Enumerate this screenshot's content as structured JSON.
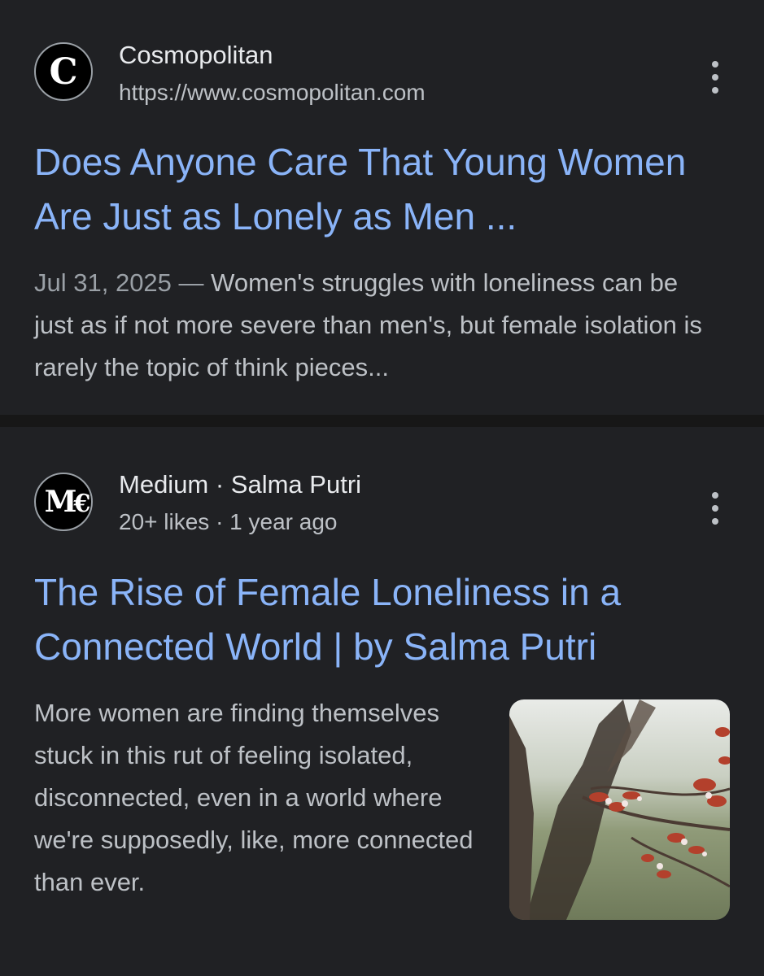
{
  "results": [
    {
      "favicon_letter": "C",
      "site_name": "Cosmopolitan",
      "url": "https://www.cosmopolitan.com",
      "title": "Does Anyone Care That Young Women Are Just as Lonely as Men ...",
      "date": "Jul 31, 2025",
      "date_separator": " — ",
      "snippet": "Women's struggles with loneliness can be just as if not more severe than men's, but female isolation is rarely the topic of think pieces..."
    },
    {
      "favicon_letter": "M",
      "site_name": "Medium · Salma Putri",
      "meta": "20+ likes · 1 year ago",
      "title": "The Rise of Female Loneliness in a Connected World | by Salma Putri",
      "snippet": "More women are finding themselves stuck in this rut of feeling isolated, disconnected, even in a world where we're supposedly, like, more connected than ever.",
      "thumbnail_icon": "blossom-branch-photo"
    }
  ],
  "colors": {
    "background": "#202124",
    "title_link": "#8ab4f8",
    "body_text": "#bdc1c6",
    "divider": "#171717"
  }
}
